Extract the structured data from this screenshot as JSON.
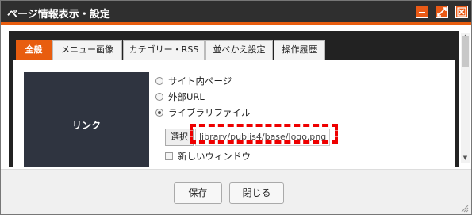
{
  "window": {
    "title": "ページ情報表示・設定"
  },
  "tabs": [
    "全般",
    "メニュー画像",
    "カテゴリー・RSS",
    "並べかえ設定",
    "操作履歴"
  ],
  "link_section": {
    "label": "リンク",
    "options": [
      "サイト内ページ",
      "外部URL",
      "ライブラリファイル"
    ],
    "selected_option_index": 2,
    "select_button": "選択",
    "file_path": "library/publis4/base/logo.png",
    "new_window_label": "新しいウィンドウ",
    "new_window_checked": false
  },
  "footer": {
    "save_label": "保存",
    "close_label": "閉じる"
  },
  "colors": {
    "accent": "#e85d0f",
    "titlebar": "#2f2f2f",
    "label_cell": "#2f3440",
    "highlight": "#ee0000"
  },
  "icons": [
    "minimize-icon",
    "maximize-icon",
    "close-icon",
    "scroll-up-icon",
    "scroll-down-icon",
    "resize-grip-icon"
  ]
}
